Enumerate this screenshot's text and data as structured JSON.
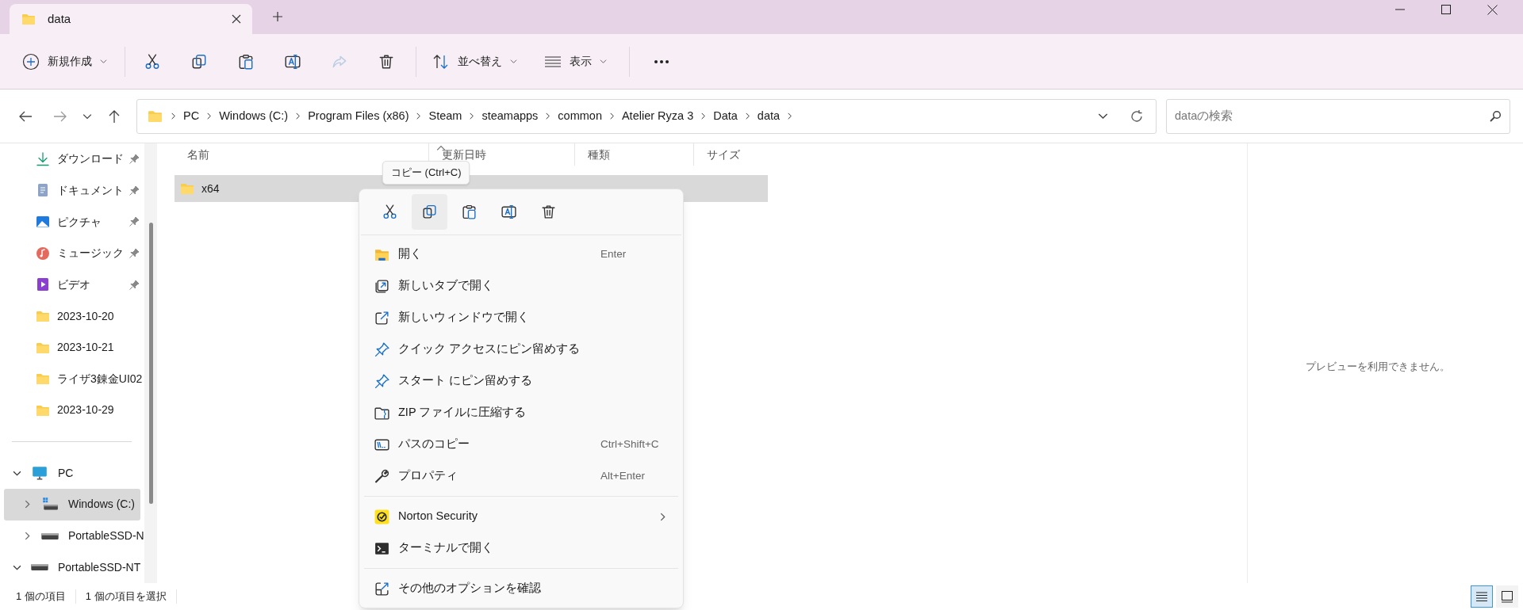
{
  "window": {
    "tabs": [
      {
        "title": "data",
        "selected": true
      }
    ]
  },
  "toolbar": {
    "new_label": "新規作成",
    "actions": [
      {
        "kind": "cut",
        "disabled": false
      },
      {
        "kind": "copy",
        "disabled": false
      },
      {
        "kind": "paste",
        "disabled": false
      },
      {
        "kind": "rename",
        "disabled": false
      },
      {
        "kind": "share",
        "disabled": true
      },
      {
        "kind": "delete",
        "disabled": false
      }
    ],
    "sort_label": "並べ替え",
    "view_label": "表示"
  },
  "address_bar": {
    "breadcrumbs": [
      "PC",
      "Windows (C:)",
      "Program Files (x86)",
      "Steam",
      "steamapps",
      "common",
      "Atelier Ryza 3",
      "Data",
      "data"
    ]
  },
  "search": {
    "placeholder": "dataの検索"
  },
  "sidebar": {
    "quick_access": [
      {
        "label": "ダウンロード",
        "kind": "download",
        "pinned": true
      },
      {
        "label": "ドキュメント",
        "kind": "document",
        "pinned": true
      },
      {
        "label": "ピクチャ",
        "kind": "pictures",
        "pinned": true
      },
      {
        "label": "ミュージック",
        "kind": "music",
        "pinned": true
      },
      {
        "label": "ビデオ",
        "kind": "video",
        "pinned": true
      },
      {
        "label": "2023-10-20",
        "kind": "folder",
        "pinned": false
      },
      {
        "label": "2023-10-21",
        "kind": "folder",
        "pinned": false
      },
      {
        "label": "ライザ3錬金UI02",
        "kind": "folder",
        "pinned": false
      },
      {
        "label": "2023-10-29",
        "kind": "folder",
        "pinned": false
      }
    ],
    "tree": [
      {
        "label": "PC",
        "kind": "pc",
        "expanded": true,
        "selected": false,
        "children": [
          {
            "label": "Windows (C:)",
            "kind": "windows-drive",
            "expanded": false,
            "selected": true
          },
          {
            "label": "PortableSSD-N",
            "kind": "drive",
            "expanded": false,
            "selected": false
          }
        ]
      },
      {
        "label": "PortableSSD-NT",
        "kind": "drive",
        "expanded": true,
        "selected": false
      }
    ]
  },
  "file_list": {
    "columns": [
      "名前",
      "更新日時",
      "種類",
      "サイズ"
    ],
    "rows": [
      {
        "name": "x64",
        "selected": true
      }
    ]
  },
  "tooltip": "コピー (Ctrl+C)",
  "context_menu": {
    "actions": [
      {
        "kind": "cut",
        "hovered": false
      },
      {
        "kind": "copy",
        "hovered": true
      },
      {
        "kind": "paste",
        "hovered": false
      },
      {
        "kind": "rename",
        "hovered": false
      },
      {
        "kind": "delete",
        "hovered": false
      }
    ],
    "groups": [
      [
        {
          "kind": "open",
          "label": "開く",
          "shortcut": "Enter",
          "submenu": false
        },
        {
          "kind": "new-tab",
          "label": "新しいタブで開く",
          "submenu": false
        },
        {
          "kind": "new-window",
          "label": "新しいウィンドウで開く",
          "submenu": false
        },
        {
          "kind": "pin",
          "label": "クイック アクセスにピン留めする",
          "submenu": false
        },
        {
          "kind": "pin",
          "label": "スタート にピン留めする",
          "submenu": false
        },
        {
          "kind": "zip",
          "label": "ZIP ファイルに圧縮する",
          "submenu": false
        },
        {
          "kind": "path",
          "label": "パスのコピー",
          "shortcut": "Ctrl+Shift+C",
          "submenu": false
        },
        {
          "kind": "wrench",
          "label": "プロパティ",
          "shortcut": "Alt+Enter",
          "submenu": false
        }
      ],
      [
        {
          "kind": "norton",
          "label": "Norton Security",
          "submenu": true
        },
        {
          "kind": "terminal",
          "label": "ターミナルで開く",
          "submenu": false
        }
      ],
      [
        {
          "kind": "more",
          "label": "その他のオプションを確認",
          "submenu": false
        }
      ]
    ]
  },
  "preview": {
    "message": "プレビューを利用できません。"
  },
  "status_bar": {
    "item_count": "1 個の項目",
    "selection": "1 個の項目を選択",
    "views": [
      {
        "kind": "details",
        "selected": true
      },
      {
        "kind": "tiles",
        "selected": false
      }
    ]
  }
}
